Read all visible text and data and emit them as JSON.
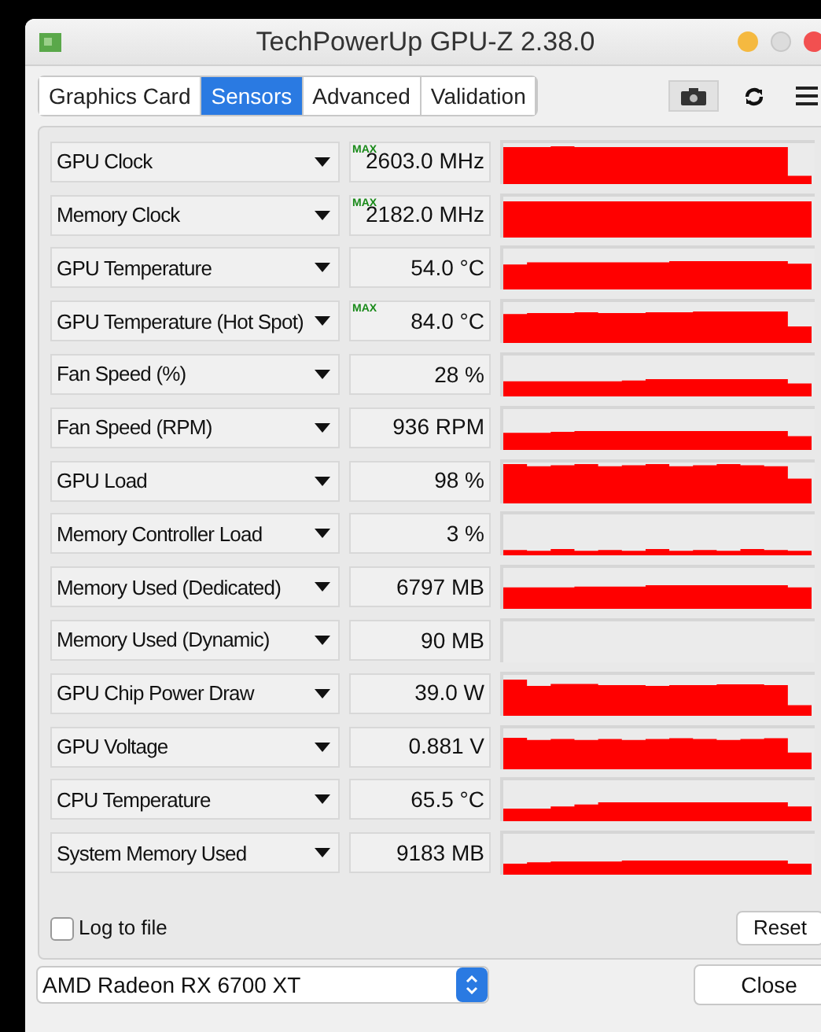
{
  "window": {
    "title": "TechPowerUp GPU-Z 2.38.0"
  },
  "tabs": [
    {
      "label": "Graphics Card",
      "selected": false
    },
    {
      "label": "Sensors",
      "selected": true
    },
    {
      "label": "Advanced",
      "selected": false
    },
    {
      "label": "Validation",
      "selected": false
    }
  ],
  "sensors": [
    {
      "name": "GPU Clock",
      "badge": "MAX",
      "value": "2603.0 MHz"
    },
    {
      "name": "Memory Clock",
      "badge": "MAX",
      "value": "2182.0 MHz"
    },
    {
      "name": "GPU Temperature",
      "value": "54.0 °C"
    },
    {
      "name": "GPU Temperature (Hot Spot)",
      "badge": "MAX",
      "value": "84.0 °C"
    },
    {
      "name": "Fan Speed (%)",
      "value": "28 %"
    },
    {
      "name": "Fan Speed (RPM)",
      "value": "936 RPM"
    },
    {
      "name": "GPU Load",
      "value": "98 %"
    },
    {
      "name": "Memory Controller Load",
      "value": "3 %"
    },
    {
      "name": "Memory Used (Dedicated)",
      "value": "6797 MB"
    },
    {
      "name": "Memory Used (Dynamic)",
      "value": "90 MB"
    },
    {
      "name": "GPU Chip Power Draw",
      "value": "39.0 W"
    },
    {
      "name": "GPU Voltage",
      "value": "0.881 V"
    },
    {
      "name": "CPU Temperature",
      "value": "65.5 °C"
    },
    {
      "name": "System Memory Used",
      "value": "9183 MB"
    }
  ],
  "log_to_file": {
    "label": "Log to file",
    "checked": false
  },
  "reset_button": "Reset",
  "device_select": {
    "value": "AMD Radeon RX 6700 XT"
  },
  "close_button": "Close"
}
